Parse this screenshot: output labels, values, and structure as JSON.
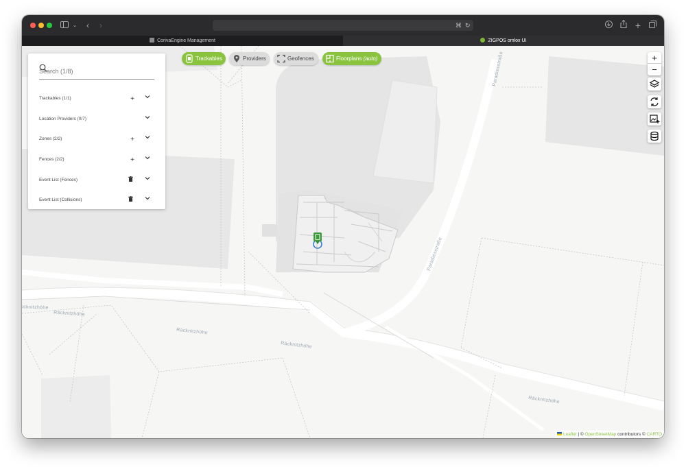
{
  "browser": {
    "tabs": [
      {
        "label": "CorivaEngine Management",
        "active": false
      },
      {
        "label": "ZIGPOS omlox UI",
        "active": true
      }
    ]
  },
  "search": {
    "placeholder": "Search (1/8)"
  },
  "sections": [
    {
      "label": "Trackables (1/1)",
      "action": "plus-icon"
    },
    {
      "label": "Location Providers (0/7)",
      "action": null
    },
    {
      "label": "Zones (2/2)",
      "action": "plus-icon"
    },
    {
      "label": "Fences (2/2)",
      "action": "plus-icon"
    },
    {
      "label": "Event List (Fences)",
      "action": "trash-icon"
    },
    {
      "label": "Event List (Collisions)",
      "action": "trash-icon"
    }
  ],
  "toolbar": {
    "trackables": "Trackables",
    "providers": "Providers",
    "geofences": "Geofences",
    "floorplans": "Floorplans",
    "floorplans_mode": "(auto)"
  },
  "map_controls": {
    "zoom_in": "+",
    "zoom_out": "−"
  },
  "streets": {
    "racknitzhoehe": "Räcknitzhöhe",
    "racknitzhoehe_cut": "ücknitzhöhe",
    "paradiesstrasse": "Paradiesstraße"
  },
  "attribution": {
    "leaflet": "Leaflet",
    "osm": "OpenStreetMap",
    "contributors": " contributors © ",
    "carto": "CARTO",
    "sep": " | © "
  },
  "colors": {
    "accent": "#8ac43f",
    "marker_ring": "#3d7fd6"
  }
}
